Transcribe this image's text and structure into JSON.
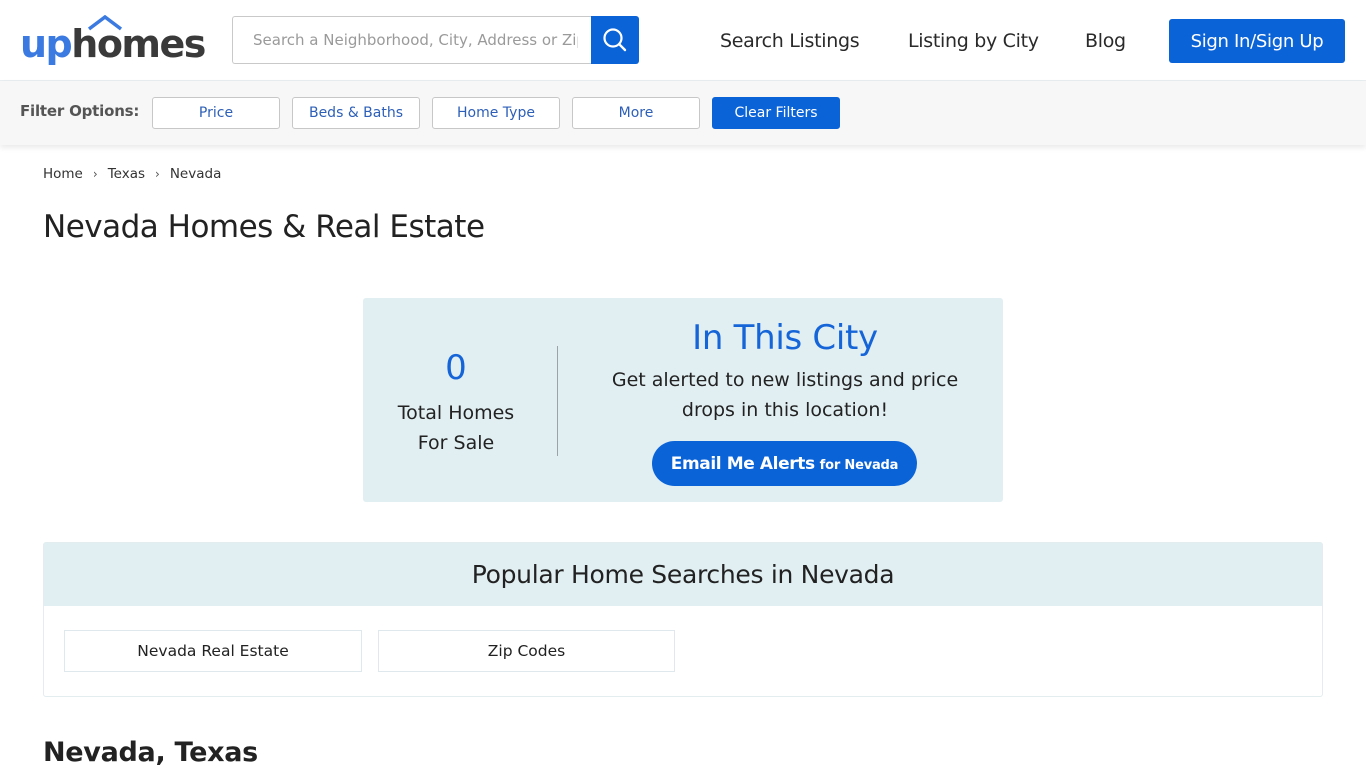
{
  "header": {
    "logo": {
      "part1": "up",
      "part2": "homes"
    },
    "search": {
      "placeholder": "Search a Neighborhood, City, Address or Zip"
    },
    "nav": [
      "Search Listings",
      "Listing by City",
      "Blog"
    ],
    "signin_label": "Sign In/Sign Up"
  },
  "filters": {
    "label": "Filter Options:",
    "buttons": [
      "Price",
      "Beds & Baths",
      "Home Type",
      "More"
    ],
    "clear_label": "Clear Filters"
  },
  "breadcrumb": [
    "Home",
    "Texas",
    "Nevada"
  ],
  "page_title": "Nevada Homes & Real Estate",
  "alert": {
    "count": "0",
    "count_label_1": "Total Homes",
    "count_label_2": "For Sale",
    "title": "In This City",
    "desc_1": "Get alerted to new listings and price",
    "desc_2": "drops in this location!",
    "button_main": "Email Me Alerts",
    "button_sub": "for Nevada"
  },
  "popular": {
    "title": "Popular Home Searches in Nevada",
    "links": [
      "Nevada Real Estate",
      "Zip Codes"
    ]
  },
  "section_title": "Nevada, Texas",
  "colors": {
    "brand_blue": "#0b63d8",
    "accent_text": "#1565d8",
    "panel_bg": "#e1eff3"
  }
}
